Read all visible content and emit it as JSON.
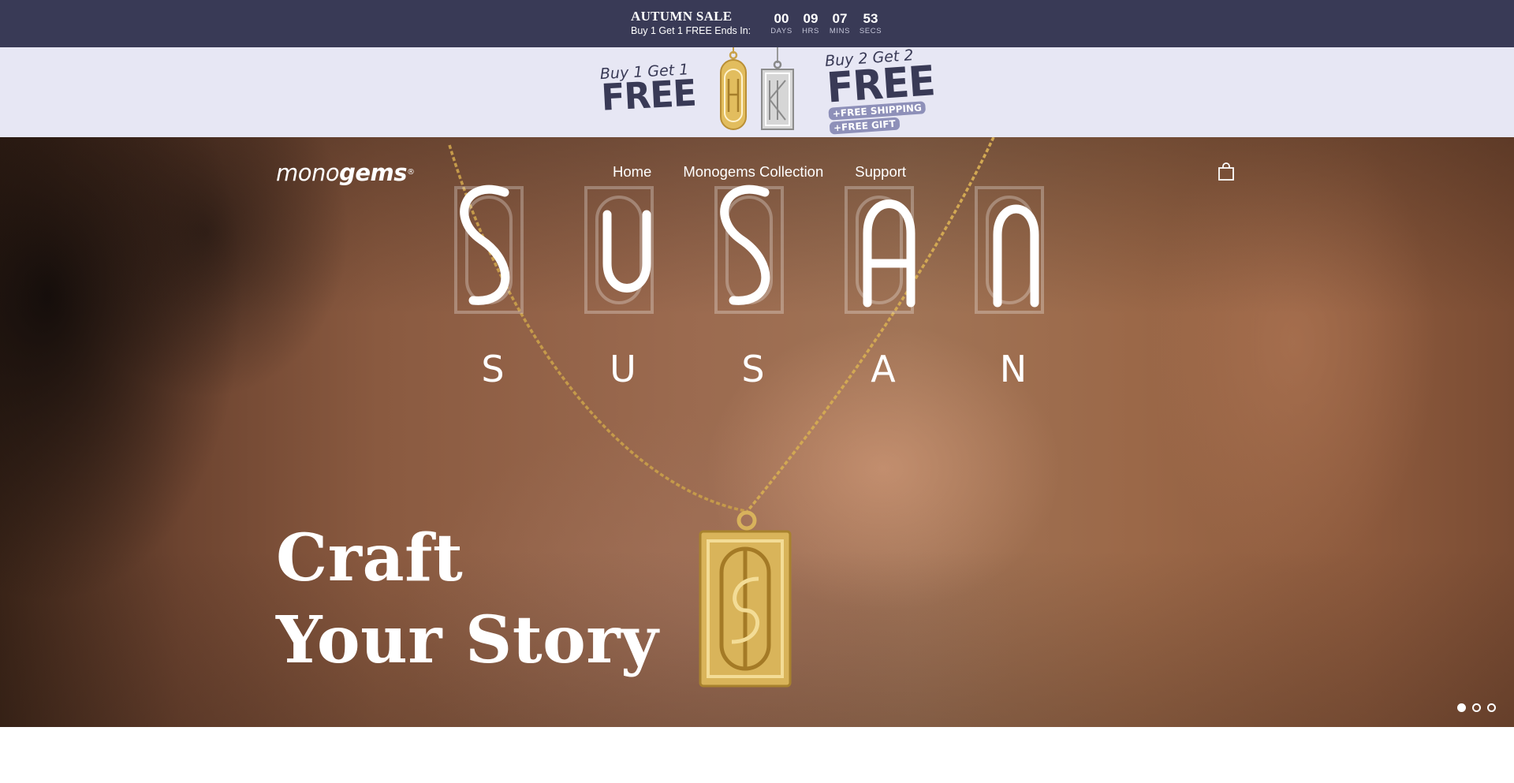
{
  "announcement": {
    "title": "AUTUMN SALE",
    "subtitle": "Buy 1 Get 1 FREE Ends In:",
    "countdown": [
      {
        "value": "00",
        "label": "DAYS"
      },
      {
        "value": "09",
        "label": "HRS"
      },
      {
        "value": "07",
        "label": "MINS"
      },
      {
        "value": "53",
        "label": "SECS"
      }
    ]
  },
  "promo": {
    "left_small": "Buy 1 Get 1",
    "left_big": "FREE",
    "right_small": "Buy 2 Get 2",
    "right_big": "FREE",
    "pill_shipping": "+FREE SHIPPING",
    "pill_gift": "+FREE GIFT"
  },
  "header": {
    "logo_light": "mono",
    "logo_bold": "gems",
    "logo_mark": "®",
    "nav": [
      "Home",
      "Monogems Collection",
      "Support"
    ],
    "cart_icon": "shopping-bag-icon"
  },
  "hero": {
    "name_letters": [
      "S",
      "U",
      "S",
      "A",
      "N"
    ],
    "headline_line1": "Craft",
    "headline_line2": "Your Story",
    "slides_total": 3,
    "active_slide": 1
  },
  "colors": {
    "topbar": "#393a56",
    "promo_bg": "#e7e7f4",
    "promo_text": "#393a56",
    "gold": "#d9b45a"
  }
}
